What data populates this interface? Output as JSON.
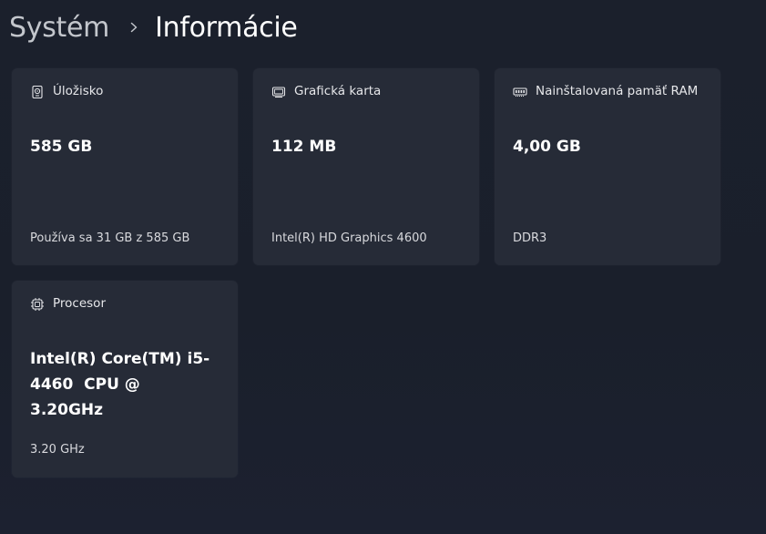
{
  "breadcrumb": {
    "parent": "Systém",
    "current": "Informácie"
  },
  "cards": {
    "storage": {
      "icon": "hard-drive-icon",
      "title": "Úložisko",
      "value": "585 GB",
      "detail": "Používa sa 31 GB z 585 GB"
    },
    "gpu": {
      "icon": "display-adapter-icon",
      "title": "Grafická karta",
      "value": "112 MB",
      "detail": "Intel(R) HD Graphics 4600"
    },
    "ram": {
      "icon": "memory-module-icon",
      "title": "Nainštalovaná pamäť RAM",
      "value": "4,00 GB",
      "detail": "DDR3"
    },
    "cpu": {
      "icon": "processor-chip-icon",
      "title": "Procesor",
      "value": "Intel(R) Core(TM) i5-4460  CPU @ 3.20GHz",
      "detail": "3.20 GHz"
    }
  },
  "colors": {
    "background": "#1b202c",
    "card": "#262b37",
    "text": "#ffffff",
    "muted": "#c3c6cc"
  }
}
